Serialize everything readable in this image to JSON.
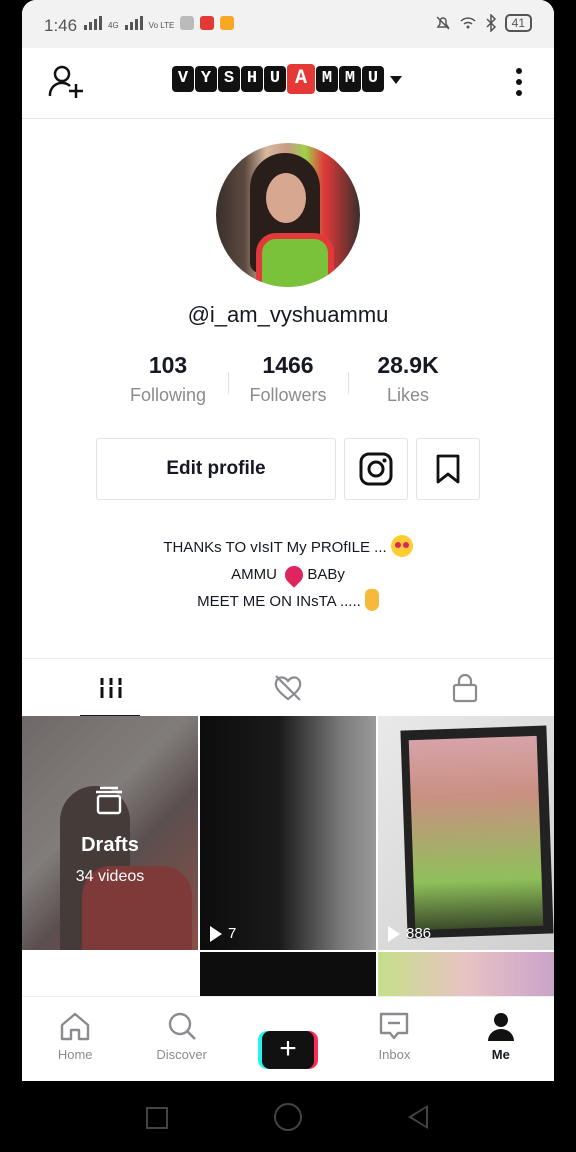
{
  "status_bar": {
    "time": "1:46",
    "network_label": "4G",
    "volte_label": "Vo LTE",
    "battery": "41"
  },
  "header": {
    "title_letters": [
      "V",
      "Y",
      "S",
      "H",
      "U",
      "A",
      "M",
      "M",
      "U"
    ],
    "highlight_index": 5
  },
  "profile": {
    "username": "@i_am_vyshuammu",
    "stats": [
      {
        "value": "103",
        "label": "Following"
      },
      {
        "value": "1466",
        "label": "Followers"
      },
      {
        "value": "28.9K",
        "label": "Likes"
      }
    ],
    "edit_label": "Edit profile",
    "bio_lines": [
      "THANKs TO vIsIT My PROfILE ...",
      "AMMU",
      "BABy",
      "MEET ME ON INsTA .....",
      ""
    ]
  },
  "grid": {
    "drafts_title": "Drafts",
    "drafts_count": "34 videos",
    "video2_views": "7",
    "video3_views": "886"
  },
  "bottom_nav": {
    "home": "Home",
    "discover": "Discover",
    "inbox": "Inbox",
    "me": "Me"
  },
  "colors": {
    "accent_red": "#fe2c55",
    "accent_cyan": "#25f4ee",
    "text_primary": "#161823",
    "text_secondary": "#8a8b91"
  }
}
